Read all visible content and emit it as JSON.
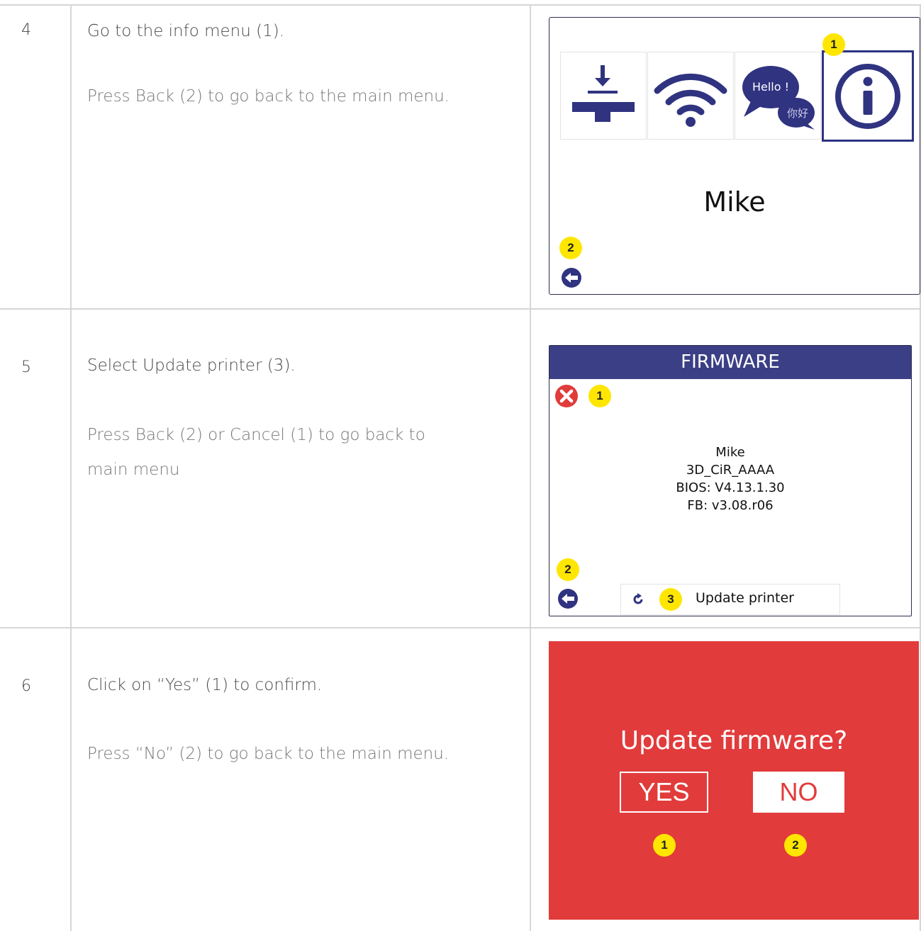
{
  "rows": [
    {
      "number": "4",
      "instruction": "Go to the info menu (1).",
      "subtext": "Press Back (2) to go back to the main menu."
    },
    {
      "number": "5",
      "instruction": "Select Update printer (3).",
      "subtext_line1": "Press Back (2) or Cancel (1) to go back to",
      "subtext_line2": "main menu"
    },
    {
      "number": "6",
      "instruction": "Click on “Yes” (1) to confirm.",
      "subtext": "Press “No” (2) to go back to the main menu."
    }
  ],
  "screen_main_menu": {
    "tiles": [
      {
        "icon": "build-plate-icon"
      },
      {
        "icon": "wifi-icon"
      },
      {
        "icon": "language-icon",
        "bubble1": "Hello !",
        "bubble2": "你好"
      },
      {
        "icon": "info-icon"
      }
    ],
    "printer_name": "Mike",
    "badge_info": "1",
    "badge_back": "2"
  },
  "screen_firmware": {
    "title": "FIRMWARE",
    "info": [
      "Mike",
      "3D_CiR_AAAA",
      "BIOS: V4.13.1.30",
      "FB: v3.08.r06"
    ],
    "update_label": "Update printer",
    "badge_cancel": "1",
    "badge_back": "2",
    "badge_update": "3"
  },
  "screen_confirm": {
    "question": "Update firmware?",
    "yes_label": "YES",
    "no_label": "NO",
    "badge_yes": "1",
    "badge_no": "2"
  },
  "colors": {
    "navy": "#3b3f85",
    "badge_yellow": "#ffe600",
    "confirm_red": "#e13b3b"
  }
}
